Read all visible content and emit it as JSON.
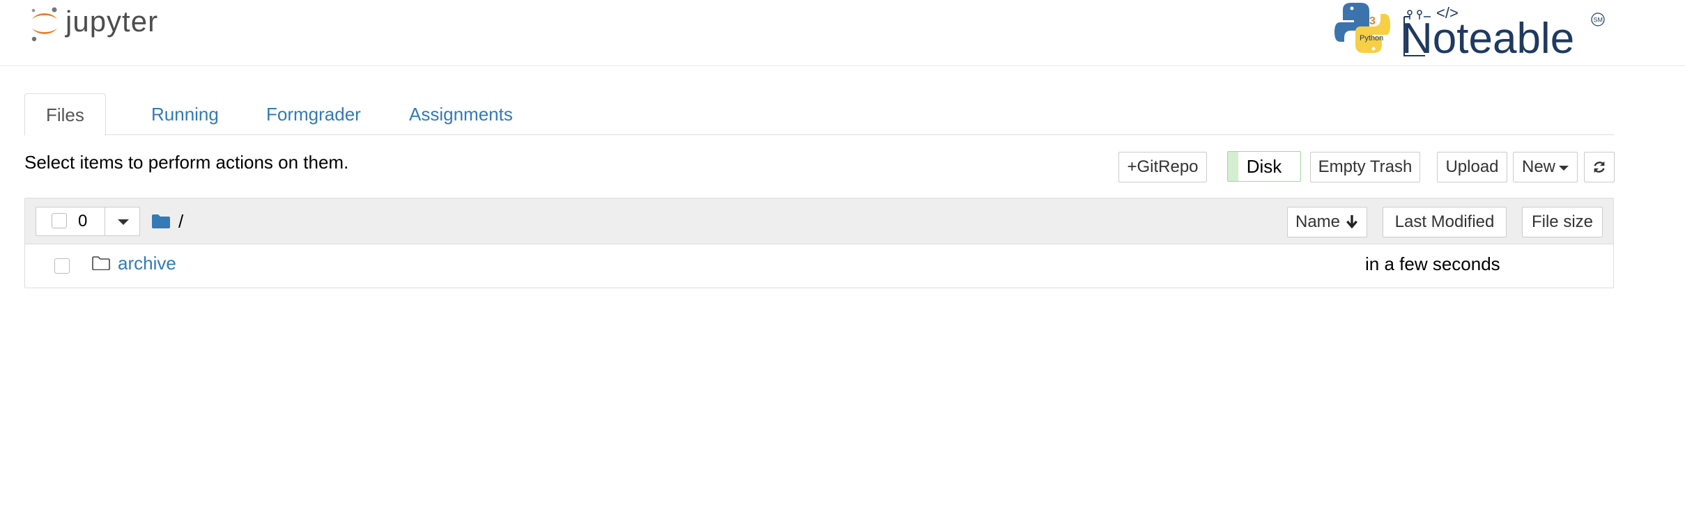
{
  "header": {
    "jupyter_logo_text": "jupyter",
    "noteable_text": "Noteable",
    "noteable_sm": "SM",
    "python_badge": "Python",
    "python_version": "3",
    "code_mark": "</>"
  },
  "tabs": [
    {
      "label": "Files",
      "active": true
    },
    {
      "label": "Running",
      "active": false
    },
    {
      "label": "Formgrader",
      "active": false
    },
    {
      "label": "Assignments",
      "active": false
    }
  ],
  "toolbar": {
    "hint": "Select items to perform actions on them.",
    "gitrepo_label": "+GitRepo",
    "disk_label": "Disk",
    "empty_trash_label": "Empty Trash",
    "upload_label": "Upload",
    "new_label": "New"
  },
  "list": {
    "selected_count": "0",
    "breadcrumb": "/",
    "columns": {
      "name": "Name",
      "last_modified": "Last Modified",
      "file_size": "File size"
    },
    "rows": [
      {
        "name": "archive",
        "type": "folder",
        "modified": "in a few seconds"
      }
    ]
  },
  "colors": {
    "link": "#337ab7",
    "jupyter_orange": "#e87d2c",
    "noteable_navy": "#1f3a5f",
    "disk_green": "#9fd89a"
  }
}
